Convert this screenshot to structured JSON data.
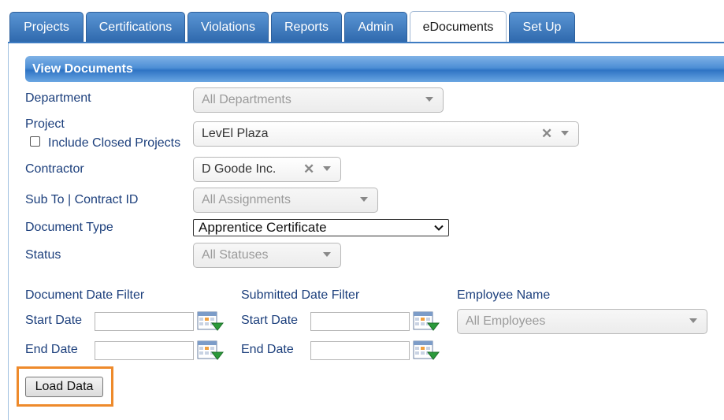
{
  "tabs": [
    {
      "label": "Projects",
      "active": false
    },
    {
      "label": "Certifications",
      "active": false
    },
    {
      "label": "Violations",
      "active": false
    },
    {
      "label": "Reports",
      "active": false
    },
    {
      "label": "Admin",
      "active": false
    },
    {
      "label": "eDocuments",
      "active": true
    },
    {
      "label": "Set Up",
      "active": false
    }
  ],
  "section_title": "View Documents",
  "form": {
    "department": {
      "label": "Department",
      "value": "All Departments"
    },
    "project": {
      "label": "Project",
      "value": "LevEl Plaza",
      "include_closed_label": "Include Closed Projects",
      "include_closed_checked": false
    },
    "contractor": {
      "label": "Contractor",
      "value": "D Goode Inc."
    },
    "sub_to": {
      "label": "Sub To | Contract ID",
      "value": "All Assignments"
    },
    "document_type": {
      "label": "Document Type",
      "value": "Apprentice Certificate"
    },
    "status": {
      "label": "Status",
      "value": "All Statuses"
    }
  },
  "date_filters": {
    "document": {
      "title": "Document Date Filter",
      "start_label": "Start Date",
      "end_label": "End Date",
      "start_value": "",
      "end_value": ""
    },
    "submitted": {
      "title": "Submitted Date Filter",
      "start_label": "Start Date",
      "end_label": "End Date",
      "start_value": "",
      "end_value": ""
    }
  },
  "employee": {
    "label": "Employee Name",
    "value": "All Employees"
  },
  "load_button_label": "Load Data",
  "icons": {
    "clear": "close-x-icon",
    "dropdown": "chevron-down-icon",
    "calendar": "calendar-icon"
  },
  "colors": {
    "tab": "#3a78be",
    "header": "#4e8fd6",
    "label": "#1c3f7c",
    "highlight": "#ee8a2b"
  }
}
